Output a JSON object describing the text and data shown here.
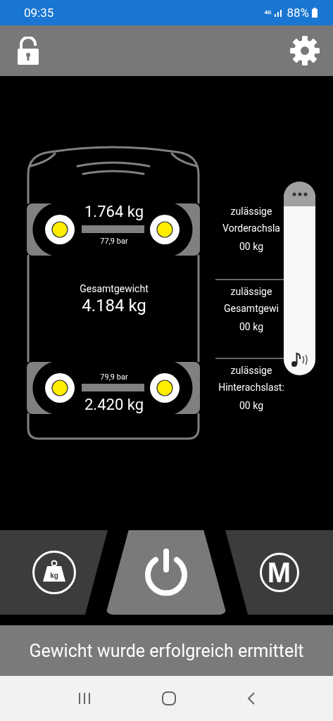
{
  "status_bar": {
    "time": "09:35",
    "network": "4G",
    "battery": "88%"
  },
  "header": {
    "lock": {
      "locked": false
    }
  },
  "axles": [
    {
      "weight": "1.764 kg",
      "pressure": "77,9 bar"
    },
    {
      "weight": "2.420 kg",
      "pressure": "79,9 bar"
    }
  ],
  "total": {
    "label": "Gesamtgewicht",
    "value": "4.184 kg"
  },
  "limits": [
    {
      "lines": [
        "zulässige",
        "Vorderachsla"
      ],
      "value": "00 kg"
    },
    {
      "lines": [
        "zulässige",
        "Gesamtgewi"
      ],
      "value": "00 kg"
    },
    {
      "lines": [
        "zulässige",
        "Hinterachslast:"
      ],
      "value": "00 kg"
    }
  ],
  "buttons": [
    {
      "kind": "weight",
      "label": "kg",
      "selected": false
    },
    {
      "kind": "power",
      "selected": true
    },
    {
      "kind": "memory",
      "label": "M",
      "selected": false
    }
  ],
  "message": "Gewicht wurde erfolgreich ermittelt"
}
